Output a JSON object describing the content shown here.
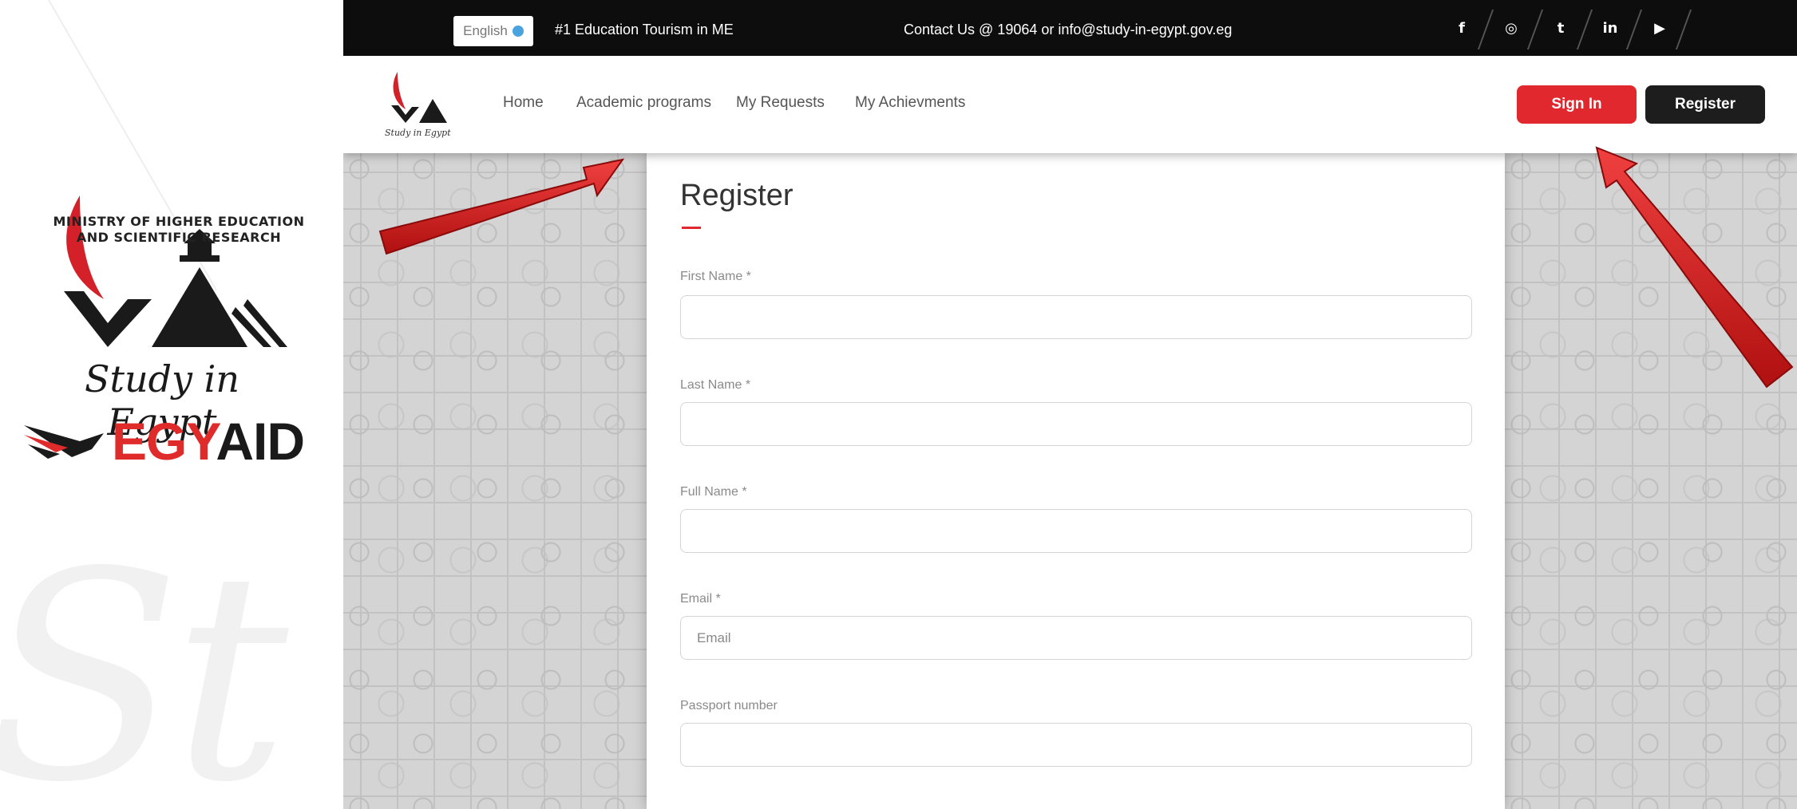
{
  "branding": {
    "ministry_line1": "MINISTRY OF HIGHER EDUCATION",
    "ministry_line2": "AND SCIENTIFIC RESEARCH",
    "script_text": "Study in Egypt",
    "egyaid_part1": "EGY",
    "egyaid_part2": "AID",
    "watermark": "St"
  },
  "topbar": {
    "language": "English",
    "tagline": "#1 Education Tourism in ME",
    "contact": "Contact Us @ 19064 or info@study-in-egypt.gov.eg",
    "social": [
      {
        "icon": "facebook-icon",
        "glyph": "f"
      },
      {
        "icon": "instagram-icon",
        "glyph": "◎"
      },
      {
        "icon": "twitter-icon",
        "glyph": "t"
      },
      {
        "icon": "linkedin-icon",
        "glyph": "in"
      },
      {
        "icon": "youtube-icon",
        "glyph": "▶"
      }
    ]
  },
  "navbar": {
    "logo_caption": "Study in Egypt",
    "links": [
      "Home",
      "Academic programs",
      "My Requests",
      "My Achievments"
    ],
    "signin_label": "Sign In",
    "register_label": "Register"
  },
  "form": {
    "title": "Register",
    "fields": [
      {
        "label": "First Name *",
        "value": "",
        "placeholder": ""
      },
      {
        "label": "Last Name *",
        "value": "",
        "placeholder": ""
      },
      {
        "label": "Full Name *",
        "value": "",
        "placeholder": ""
      },
      {
        "label": "Email *",
        "value": "",
        "placeholder": "Email"
      },
      {
        "label": "Passport number",
        "value": "",
        "placeholder": ""
      }
    ]
  },
  "colors": {
    "accent_red": "#e0282e",
    "dark": "#1d1d1d",
    "topbar_bg": "#0d0d0d"
  }
}
